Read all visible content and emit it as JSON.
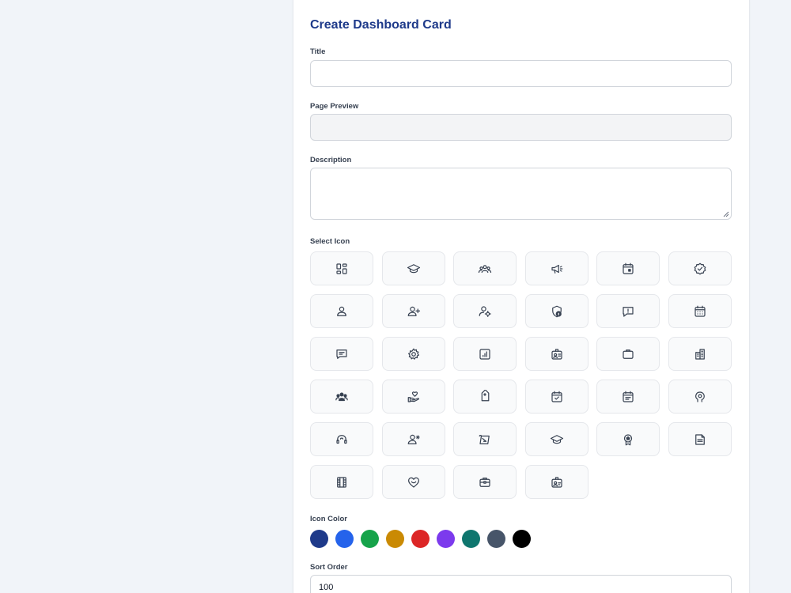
{
  "form": {
    "title": "Create Dashboard Card",
    "fields": {
      "title_label": "Title",
      "title_value": "",
      "preview_label": "Page Preview",
      "preview_value": "",
      "description_label": "Description",
      "description_value": "",
      "icon_label": "Select Icon",
      "color_label": "Icon Color",
      "sort_label": "Sort Order",
      "sort_value": "100"
    }
  },
  "icons": [
    "dashboard-grid-icon",
    "graduation-cap-icon",
    "team-icon",
    "megaphone-icon",
    "calendar-event-icon",
    "badge-check-icon",
    "user-icon",
    "user-add-icon",
    "user-settings-icon",
    "shield-info-icon",
    "alert-message-icon",
    "calendar-grid-icon",
    "chat-message-icon",
    "gear-icon",
    "report-chart-icon",
    "id-badge-icon",
    "briefcase-icon",
    "buildings-icon",
    "users-group-icon",
    "heart-hand-icon",
    "tag-icon",
    "calendar-check-icon",
    "calendar-notes-icon",
    "brain-icon",
    "headset-icon",
    "user-sparkle-icon",
    "diploma-icon",
    "graduation-cap-alt-icon",
    "award-ribbon-icon",
    "document-icon",
    "film-icon",
    "heart-smile-icon",
    "toolbox-icon",
    "id-card-icon"
  ],
  "colors": [
    "#1e3a8a",
    "#2563eb",
    "#16a34a",
    "#ca8a04",
    "#dc2626",
    "#7c3aed",
    "#0f766e",
    "#475569",
    "#000000"
  ]
}
